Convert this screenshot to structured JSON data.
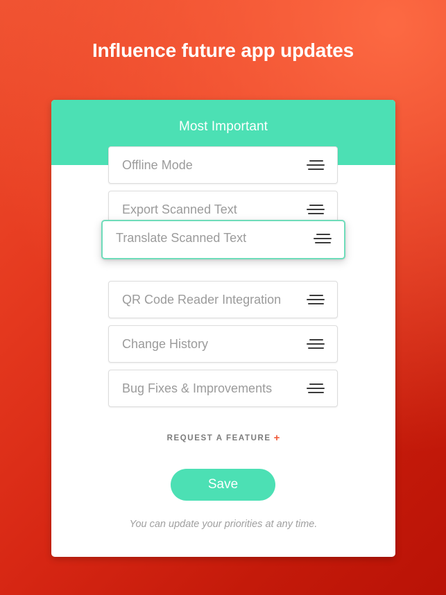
{
  "page": {
    "title": "Influence future app updates",
    "background_start_color": "#ef5130",
    "background_end_color": "#b91206"
  },
  "card": {
    "header": {
      "title": "Most Important",
      "color": "#4ce0b4"
    },
    "items": [
      {
        "label": "Offline Mode",
        "handle": "drag-handle-icon",
        "state": "normal"
      },
      {
        "label": "Export Scanned Text",
        "handle": "drag-handle-icon",
        "state": "normal"
      },
      {
        "label": "Translate Scanned Text",
        "handle": "drag-handle-icon",
        "state": "dragging"
      },
      {
        "label": "QR Code Reader Integration",
        "handle": "drag-handle-icon",
        "state": "normal"
      },
      {
        "label": "Change History",
        "handle": "drag-handle-icon",
        "state": "normal"
      },
      {
        "label": "Bug Fixes & Improvements",
        "handle": "drag-handle-icon",
        "state": "normal"
      }
    ],
    "request_feature": {
      "label": "REQUEST A FEATURE",
      "plus": "+",
      "plus_color": "#f05a3a"
    },
    "save_button": {
      "label": "Save",
      "color": "#4ce0b4"
    },
    "footer_note": "You can update your priorities at any time."
  }
}
